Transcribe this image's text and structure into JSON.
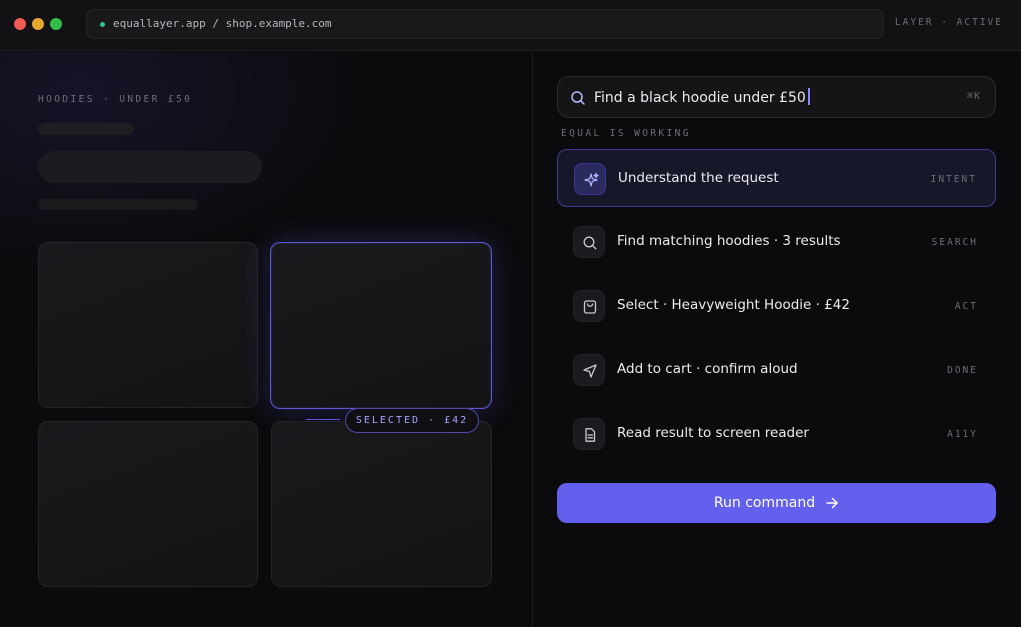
{
  "browser": {
    "url_text": "equallayer.app / shop.example.com",
    "status": "LAYER · ACTIVE"
  },
  "shop": {
    "eyebrow": "HOODIES · UNDER £50",
    "selected_badge": "SELECTED · £42"
  },
  "search": {
    "value": "Find a black hoodie under £50",
    "shortcut": "⌘K",
    "icon": "search-icon"
  },
  "agent": {
    "status_label": "EQUAL IS WORKING",
    "steps": [
      {
        "label": "Understand the request",
        "tag": "INTENT",
        "icon": "sparkle-icon",
        "active": true
      },
      {
        "label": "Find matching hoodies · 3 results",
        "tag": "SEARCH",
        "icon": "search-icon",
        "active": false
      },
      {
        "label": "Select · Heavyweight Hoodie · £42",
        "tag": "ACT",
        "icon": "shopping-bag-icon",
        "active": false
      },
      {
        "label": "Add to cart · confirm aloud",
        "tag": "DONE",
        "icon": "send-icon",
        "active": false
      },
      {
        "label": "Read result to screen reader",
        "tag": "A11Y",
        "icon": "document-icon",
        "active": false
      }
    ]
  },
  "actions": {
    "run_label": "Run command",
    "run_icon": "arrow-right-icon"
  },
  "colors": {
    "accent": "#6460EE",
    "accent_text": "#A7A3FF",
    "background": "#0B0B0D"
  }
}
